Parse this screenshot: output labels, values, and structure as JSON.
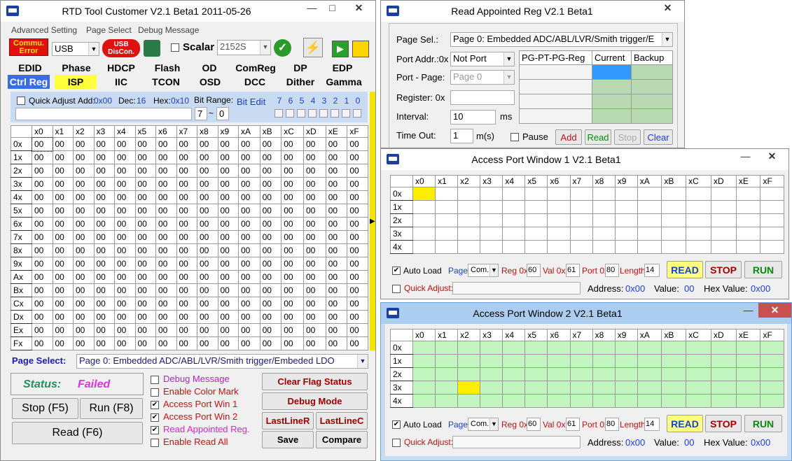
{
  "main": {
    "title": "RTD Tool Customer V2.1 Beta1    2011-05-26",
    "menu": [
      "Advanced Setting",
      "Page Select",
      "Debug Message"
    ],
    "commu_error": "Commu. Error",
    "iface": "USB",
    "usb_disconn": "USB DisCon.",
    "scalar_label": "Scalar",
    "scalar_value": "2152S",
    "tabs_row1": [
      "EDID",
      "Phase",
      "HDCP",
      "Flash",
      "OD",
      "ComReg",
      "DP",
      "EDP"
    ],
    "tabs_row2": [
      "Ctrl Reg",
      "ISP",
      "IIC",
      "TCON",
      "OSD",
      "DCC",
      "Dither",
      "Gamma"
    ],
    "quick_adjust": "Quick Adjust",
    "add_label": "Add:",
    "add_val": "0x00",
    "dec_label": "Dec:",
    "dec_val": "16",
    "hex_label": "Hex:",
    "hex_val": "0x10",
    "bit_range_label": "Bit Range:",
    "bit_from": "7",
    "bit_sep": "~",
    "bit_to": "0",
    "bit_edit_label": "Bit Edit",
    "bits": [
      "7",
      "6",
      "5",
      "4",
      "3",
      "2",
      "1",
      "0"
    ],
    "cols": [
      "x0",
      "x1",
      "x2",
      "x3",
      "x4",
      "x5",
      "x6",
      "x7",
      "x8",
      "x9",
      "xA",
      "xB",
      "xC",
      "xD",
      "xE",
      "xF"
    ],
    "rows": [
      "0x",
      "1x",
      "2x",
      "3x",
      "4x",
      "5x",
      "6x",
      "7x",
      "8x",
      "9x",
      "Ax",
      "Bx",
      "Cx",
      "Dx",
      "Ex",
      "Fx"
    ],
    "cell": "00",
    "page_select_label": "Page Select:",
    "page_select_value": "Page 0: Embedded ADC/ABL/LVR/Smith trigger/Embeded LDO",
    "status_label": "Status:",
    "status_value": "Failed",
    "stop_btn": "Stop (F5)",
    "run_btn": "Run (F8)",
    "read_btn": "Read (F6)",
    "checks": [
      {
        "label": "Debug Message",
        "checked": false,
        "color": "#c020c0"
      },
      {
        "label": "Enable Color Mark",
        "checked": false,
        "color": "#d01010"
      },
      {
        "label": "Access Port Win 1",
        "checked": true,
        "color": "#d01010"
      },
      {
        "label": "Access Port Win 2",
        "checked": true,
        "color": "#d01010"
      },
      {
        "label": "Read Appointed Reg.",
        "checked": true,
        "color": "#e020e0"
      },
      {
        "label": "Enable Read All",
        "checked": false,
        "color": "#d01010"
      }
    ],
    "clear_flag": "Clear Flag Status",
    "debug_mode": "Debug Mode",
    "lastliner": "LastLineR",
    "lastlinec": "LastLineC",
    "save": "Save",
    "compare": "Compare"
  },
  "reg": {
    "title": "Read Appointed Reg V2.1 Beta1",
    "page_sel_label": "Page Sel.:",
    "page_sel_value": "Page 0: Embedded ADC/ABL/LVR/Smith trigger/E",
    "port_addr_label": "Port Addr.:0x",
    "port_addr_value": "Not Port",
    "port_page_label": "Port - Page:",
    "port_page_value": "Page 0",
    "register_label": "Register:  0x",
    "interval_label": "Interval:",
    "interval_value": "10",
    "interval_unit": "ms",
    "timeout_label": "Time Out:",
    "timeout_value": "1",
    "timeout_unit": "m(s)",
    "pause": "Pause",
    "add": "Add",
    "read": "Read",
    "stop": "Stop",
    "clear": "Clear",
    "table_headers": [
      "PG-PT-PG-Reg",
      "Current",
      "Backup"
    ]
  },
  "ap1": {
    "title": "Access Port Window 1 V2.1 Beta1",
    "rows": [
      "0x",
      "1x",
      "2x",
      "3x",
      "4x"
    ],
    "auto_load": "Auto Load",
    "page_label": "Page",
    "page_value": "Com.",
    "reg_label": "Reg 0x",
    "reg_value": "60",
    "val_label": "Val 0x",
    "val_value": "61",
    "port_label": "Port 0x",
    "port_value": "80",
    "length_label": "Length",
    "length_value": "14",
    "read": "READ",
    "stop": "STOP",
    "run": "RUN",
    "quick_adjust": "Quick Adjust:",
    "address_label": "Address:",
    "address_value": "0x00",
    "value_label": "Value:",
    "value_value": "00",
    "hexvalue_label": "Hex Value:",
    "hexvalue_value": "0x00"
  },
  "ap2": {
    "title": "Access Port Window 2 V2.1 Beta1"
  },
  "colors": {
    "tab_blue": "#3a6ee0",
    "tab_yellow": "#ffff40",
    "status_green": "#1f9060",
    "status_mag": "#e030e0",
    "cell_blue": "#3399ff",
    "cell_grn": "#c3f5c0",
    "cell_yellow": "#ffee00"
  }
}
